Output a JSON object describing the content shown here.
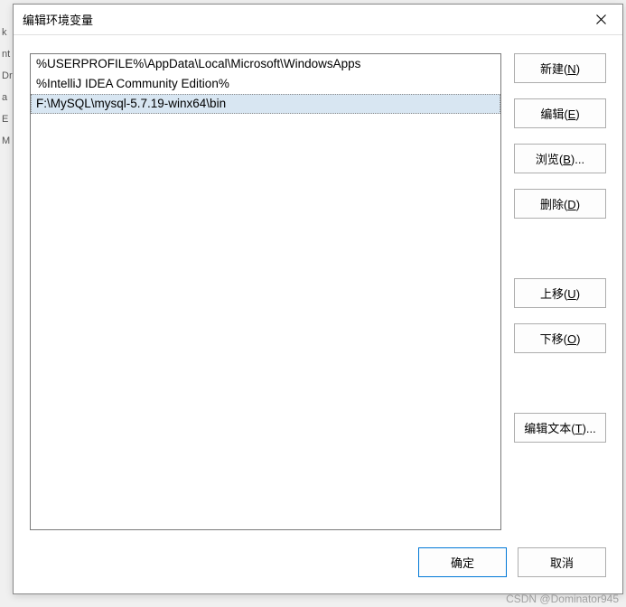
{
  "dialog": {
    "title": "编辑环境变量"
  },
  "entries": [
    "%USERPROFILE%\\AppData\\Local\\Microsoft\\WindowsApps",
    "%IntelliJ IDEA Community Edition%",
    "F:\\MySQL\\mysql-5.7.19-winx64\\bin"
  ],
  "selected_index": 2,
  "buttons": {
    "new": {
      "label": "新建(",
      "accel": "N",
      "tail": ")"
    },
    "edit": {
      "label": "编辑(",
      "accel": "E",
      "tail": ")"
    },
    "browse": {
      "label": "浏览(",
      "accel": "B",
      "tail": ")..."
    },
    "delete": {
      "label": "删除(",
      "accel": "D",
      "tail": ")"
    },
    "moveup": {
      "label": "上移(",
      "accel": "U",
      "tail": ")"
    },
    "movedown": {
      "label": "下移(",
      "accel": "O",
      "tail": ")"
    },
    "edittext": {
      "label": "编辑文本(",
      "accel": "T",
      "tail": ")..."
    },
    "ok": "确定",
    "cancel": "取消"
  },
  "watermark": "CSDN @Dominator945"
}
